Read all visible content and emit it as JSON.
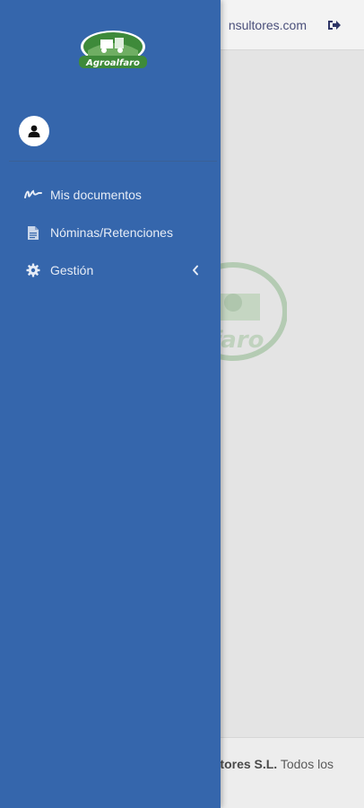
{
  "header": {
    "email_fragment": "nsultores.com",
    "logout_icon": "logout-icon"
  },
  "footer": {
    "company_bold": "tores S.L.",
    "rights_text": "Todos los"
  },
  "drawer": {
    "logo_text": "Agroalfaro",
    "user_icon": "user-icon",
    "menu": [
      {
        "label": "Mis documentos",
        "icon": "signature-icon"
      },
      {
        "label": "Nóminas/Retenciones",
        "icon": "document-icon"
      },
      {
        "label": "Gestión",
        "icon": "gear-icon",
        "has_submenu": true
      }
    ]
  },
  "colors": {
    "drawer_bg": "#3566ac",
    "menu_text": "#e6ecf6",
    "logo_green": "#3e8a3a",
    "header_text": "#4a4f7a"
  }
}
